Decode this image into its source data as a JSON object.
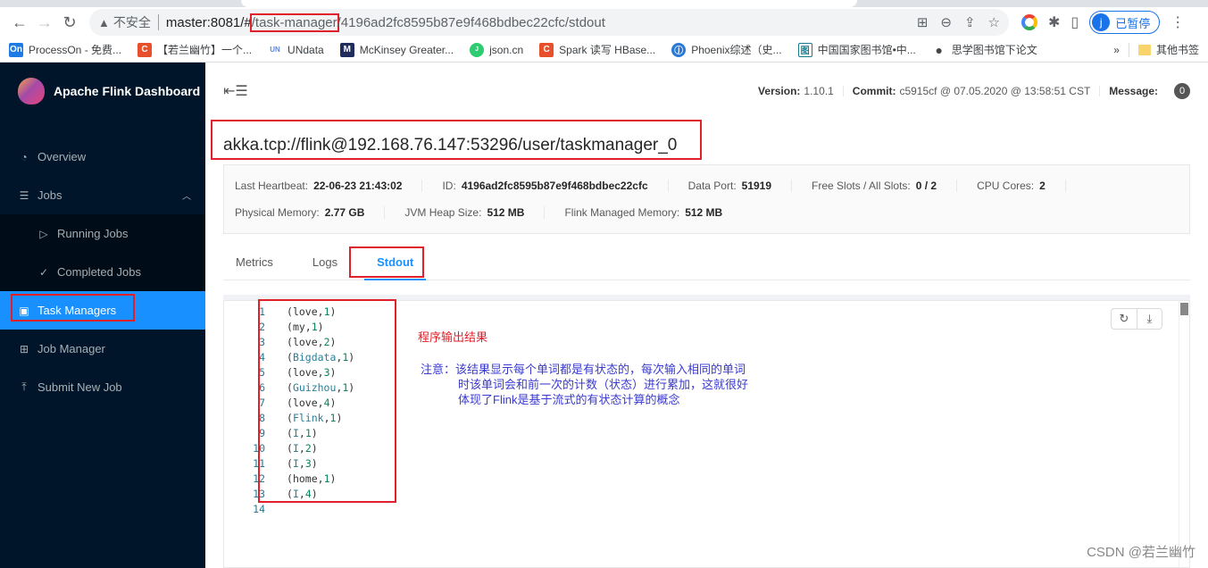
{
  "browser": {
    "insecure_label": "不安全",
    "url_host": "master:8081/#",
    "url_highlight": "/task-manager",
    "url_rest": "/4196ad2fc8595b87e9f468bdbec22cfc/stdout",
    "profile_initial": "j",
    "profile_status": "已暂停",
    "bookmarks": [
      {
        "label": "ProcessOn - 免费...",
        "icon": "On",
        "color": "#1e7be6"
      },
      {
        "label": "【若兰幽竹】一个...",
        "icon": "C",
        "color": "#e8502b"
      },
      {
        "label": "UNdata",
        "icon": "UN",
        "color": "#5b8ad8"
      },
      {
        "label": "McKinsey Greater...",
        "icon": "M",
        "color": "#1f2c5c"
      },
      {
        "label": "json.cn",
        "icon": "J",
        "color": "#2ecc71"
      },
      {
        "label": "Spark 读写 HBase...",
        "icon": "C",
        "color": "#e8502b"
      },
      {
        "label": "Phoenix综述（史...",
        "icon": "ⓙ",
        "color": "#2b78d6"
      },
      {
        "label": "中国国家图书馆•中...",
        "icon": "图",
        "color": "#1a7b8c"
      },
      {
        "label": "思学图书馆下论文",
        "icon": "●",
        "color": "#444"
      }
    ],
    "more_bookmarks_chevron": "»",
    "other_bookmarks": "其他书签"
  },
  "sidebar": {
    "title": "Apache Flink Dashboard",
    "items": [
      {
        "label": "Overview",
        "icon": "dashboard-icon"
      },
      {
        "label": "Jobs",
        "icon": "list-icon"
      },
      {
        "label": "Running Jobs",
        "icon": "play-circle-icon"
      },
      {
        "label": "Completed Jobs",
        "icon": "check-circle-icon"
      },
      {
        "label": "Task Managers",
        "icon": "schedule-icon"
      },
      {
        "label": "Job Manager",
        "icon": "cluster-icon"
      },
      {
        "label": "Submit New Job",
        "icon": "upload-icon"
      }
    ]
  },
  "header": {
    "version_label": "Version:",
    "version": "1.10.1",
    "commit_label": "Commit:",
    "commit": "c5915cf @ 07.05.2020 @ 13:58:51 CST",
    "message_label": "Message:",
    "message_count": "0"
  },
  "taskmanager": {
    "title": "akka.tcp://flink@192.168.76.147:53296/user/taskmanager_0",
    "details_row1": [
      {
        "label": "Last Heartbeat:",
        "value": "22-06-23 21:43:02"
      },
      {
        "label": "ID:",
        "value": "4196ad2fc8595b87e9f468bdbec22cfc"
      },
      {
        "label": "Data Port:",
        "value": "51919"
      },
      {
        "label": "Free Slots / All Slots:",
        "value": "0 / 2"
      },
      {
        "label": "CPU Cores:",
        "value": "2"
      }
    ],
    "details_row2": [
      {
        "label": "Physical Memory:",
        "value": "2.77 GB"
      },
      {
        "label": "JVM Heap Size:",
        "value": "512 MB"
      },
      {
        "label": "Flink Managed Memory:",
        "value": "512 MB"
      }
    ],
    "tabs": [
      "Metrics",
      "Logs",
      "Stdout"
    ],
    "active_tab": "Stdout"
  },
  "stdout": {
    "lines": [
      {
        "n": "1",
        "word": "love",
        "count": "1"
      },
      {
        "n": "2",
        "word": "my",
        "count": "1"
      },
      {
        "n": "3",
        "word": "love",
        "count": "2"
      },
      {
        "n": "4",
        "word": "Bigdata",
        "count": "1"
      },
      {
        "n": "5",
        "word": "love",
        "count": "3"
      },
      {
        "n": "6",
        "word": "Guizhou",
        "count": "1"
      },
      {
        "n": "7",
        "word": "love",
        "count": "4"
      },
      {
        "n": "8",
        "word": "Flink",
        "count": "1"
      },
      {
        "n": "9",
        "word": "I",
        "count": "1"
      },
      {
        "n": "10",
        "word": "I",
        "count": "2"
      },
      {
        "n": "11",
        "word": "I",
        "count": "3"
      },
      {
        "n": "12",
        "word": "home",
        "count": "1"
      },
      {
        "n": "13",
        "word": "I",
        "count": "4"
      },
      {
        "n": "14",
        "word": "",
        "count": ""
      }
    ]
  },
  "annotations": {
    "title": "程序输出结果",
    "note_line1": "注意：该结果显示每个单词都是有状态的，每次输入相同的单词",
    "note_line2": "时该单词会和前一次的计数（状态）进行累加，这就很好",
    "note_line3": "体现了Flink是基于流式的有状态计算的概念"
  },
  "watermark": "CSDN @若兰幽竹"
}
